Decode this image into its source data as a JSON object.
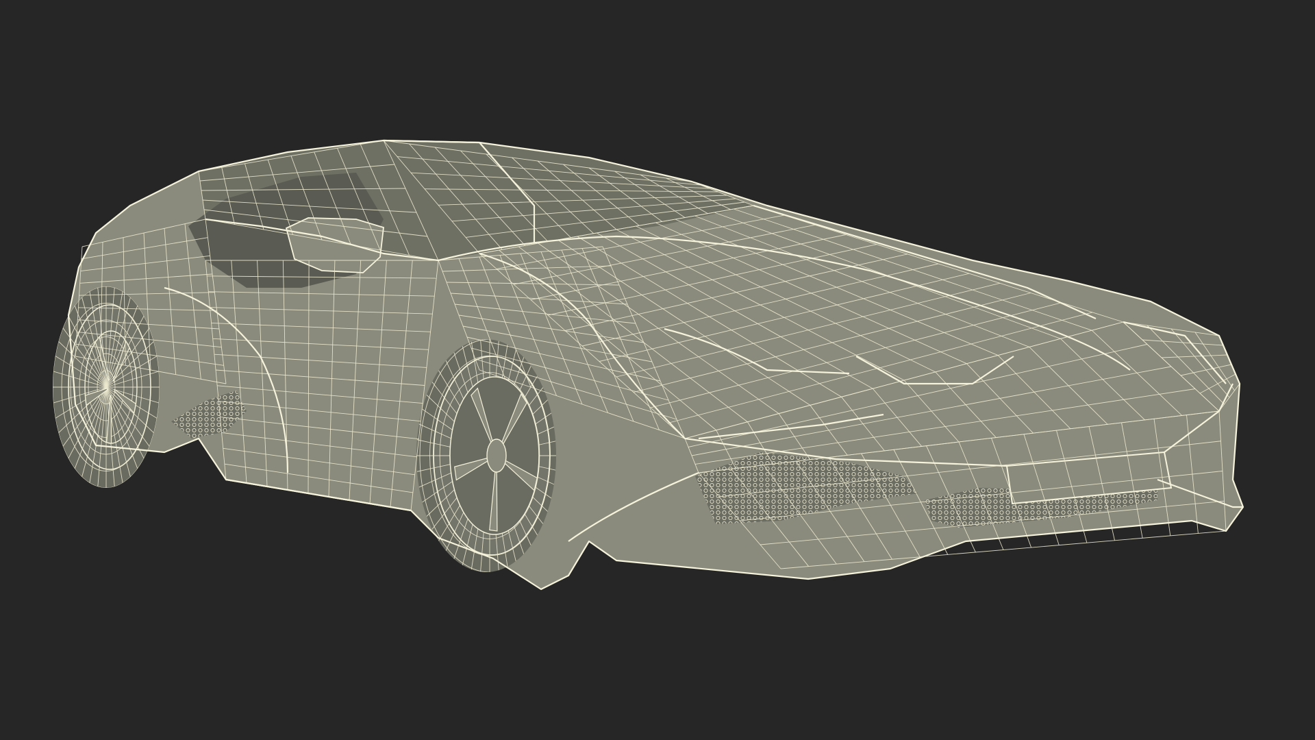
{
  "scene": {
    "subject": "sports-car-wireframe",
    "background_color": "#262626",
    "body_color": "#8a8b7c",
    "wire_color": "#f2f0d8"
  }
}
